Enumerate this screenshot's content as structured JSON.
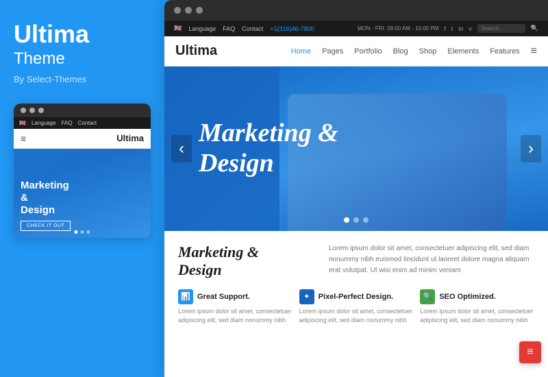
{
  "left": {
    "brand_title": "Ultima",
    "brand_subtitle": "Theme",
    "brand_by": "By Select-Themes",
    "mobile": {
      "titlebar_dots": [
        "●",
        "●",
        "●"
      ],
      "topbar_flag": "🇬🇧",
      "topbar_language": "Language",
      "topbar_faq": "FAQ",
      "topbar_contact": "Contact",
      "nav_logo": "Ultima",
      "hero_title": "Marketing\n&\nDesign",
      "hero_btn": "CHECK IT OUT",
      "dots": [
        true,
        false,
        false
      ]
    }
  },
  "right": {
    "titlebar_dots": [
      "●",
      "●",
      "●"
    ],
    "topbar": {
      "flag": "🇬🇧",
      "language": "Language",
      "faq": "FAQ",
      "contact": "Contact",
      "phone": "+1(316)46-7800",
      "hours": "MON - FRI: 09:00 AM - 10:00 PM",
      "search_placeholder": "Search..."
    },
    "nav": {
      "logo": "Ultima",
      "links": [
        "Home",
        "Pages",
        "Portfolio",
        "Blog",
        "Shop",
        "Elements",
        "Features"
      ],
      "active": "Home"
    },
    "hero": {
      "title_line1": "Marketing &",
      "title_line2": "Design",
      "dots": [
        true,
        false,
        false
      ],
      "arrow_left": "‹",
      "arrow_right": "›"
    },
    "content": {
      "heading_line1": "Marketing &",
      "heading_line2": "Design",
      "para": "Lorem ipsum dolor sit amet, consectetuer adipiscing elit, sed diam nonummy nibh euismod tincidunt ut laoreet dolore magna aliquam erat volutpat. Ut wisi enim ad minim veniam"
    },
    "features": [
      {
        "icon": "📊",
        "title": "Great Support.",
        "para": "Lorem ipsum dolor sit amet, consectetuer adipiscing elit, sed diam nonummy nibh"
      },
      {
        "icon": "✦",
        "title": "Pixel-Perfect Design.",
        "para": "Lorem ipsum dolor sit amet, consectetuer adipiscing elit, sed diam nonummy nibh"
      },
      {
        "icon": "🔍",
        "title": "SEO Optimized.",
        "para": "Lorem ipsum dolor sit amet, consectetuer adipiscing elit, sed diam nonummy nibh"
      }
    ]
  },
  "corner_btn": "≡"
}
